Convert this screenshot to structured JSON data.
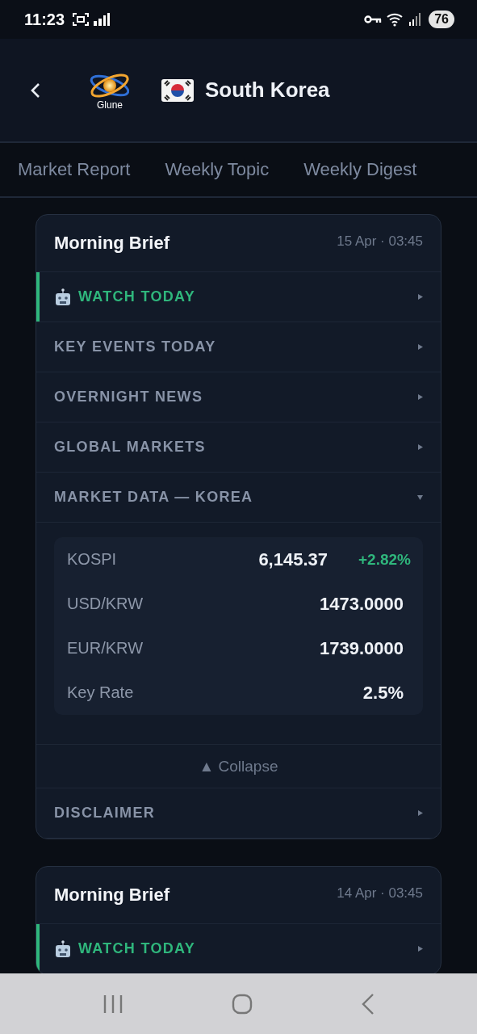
{
  "status_bar": {
    "time": "11:23",
    "battery": "76"
  },
  "header": {
    "logo_text": "Glune",
    "title": "South Korea"
  },
  "tabs": [
    {
      "label": "Market Report",
      "selected": false
    },
    {
      "label": "Weekly Topic",
      "selected": false
    },
    {
      "label": "Weekly Digest",
      "selected": false
    }
  ],
  "briefs": [
    {
      "title": "Morning Brief",
      "date": "15 Apr · 03:45",
      "sections": [
        {
          "label": "WATCH TODAY",
          "kind": "highlight",
          "expanded": false
        },
        {
          "label": "KEY EVENTS TODAY",
          "kind": "plain",
          "expanded": false
        },
        {
          "label": "OVERNIGHT NEWS",
          "kind": "plain",
          "expanded": false
        },
        {
          "label": "GLOBAL MARKETS",
          "kind": "plain",
          "expanded": false
        },
        {
          "label": "MARKET DATA — KOREA",
          "kind": "plain",
          "expanded": true,
          "collapse_label": "▲ Collapse",
          "rows": [
            {
              "name": "KOSPI",
              "value": "6,145.37",
              "change": "+2.82%"
            },
            {
              "name": "USD/KRW",
              "value": "1473.0000"
            },
            {
              "name": "EUR/KRW",
              "value": "1739.0000"
            },
            {
              "name": "Key Rate",
              "value": "2.5%"
            }
          ]
        },
        {
          "label": "DISCLAIMER",
          "kind": "plain",
          "expanded": false
        }
      ]
    },
    {
      "title": "Morning Brief",
      "date": "14 Apr · 03:45",
      "sections": [
        {
          "label": "WATCH TODAY",
          "kind": "highlight",
          "expanded": false
        }
      ]
    }
  ]
}
